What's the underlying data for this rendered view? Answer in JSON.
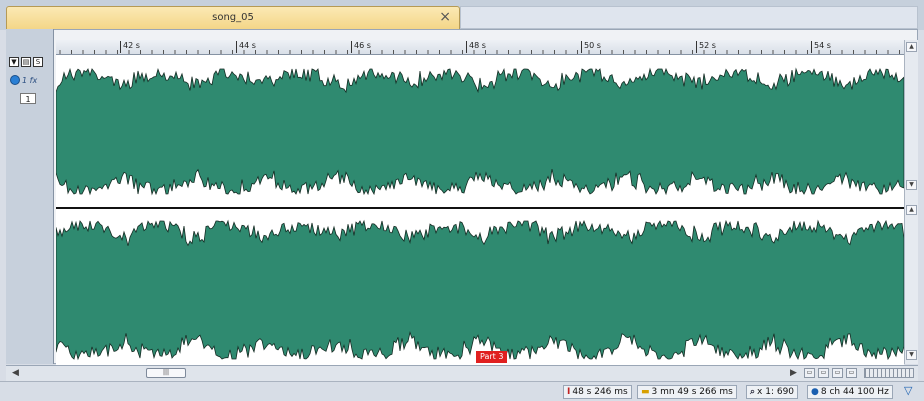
{
  "tab": {
    "title": "song_05",
    "close": "×"
  },
  "sidebar": {
    "fx_label": "1 fx",
    "channel": "1",
    "buttons": [
      "▼",
      "▤",
      "S"
    ]
  },
  "ruler": {
    "ticks": [
      "42 s",
      "44 s",
      "46 s",
      "48 s",
      "50 s",
      "52 s",
      "54 s"
    ]
  },
  "marker": {
    "label": "Part 3"
  },
  "status": {
    "cursor": "48 s 246 ms",
    "length": "3 mn 49 s 266 ms",
    "zoom": "x 1: 690",
    "format": "8 ch 44 100 Hz"
  },
  "colors": {
    "waveform": "#2f8a70",
    "outline": "#142a22",
    "marker": "#e02020",
    "tab": "#f4d688"
  }
}
